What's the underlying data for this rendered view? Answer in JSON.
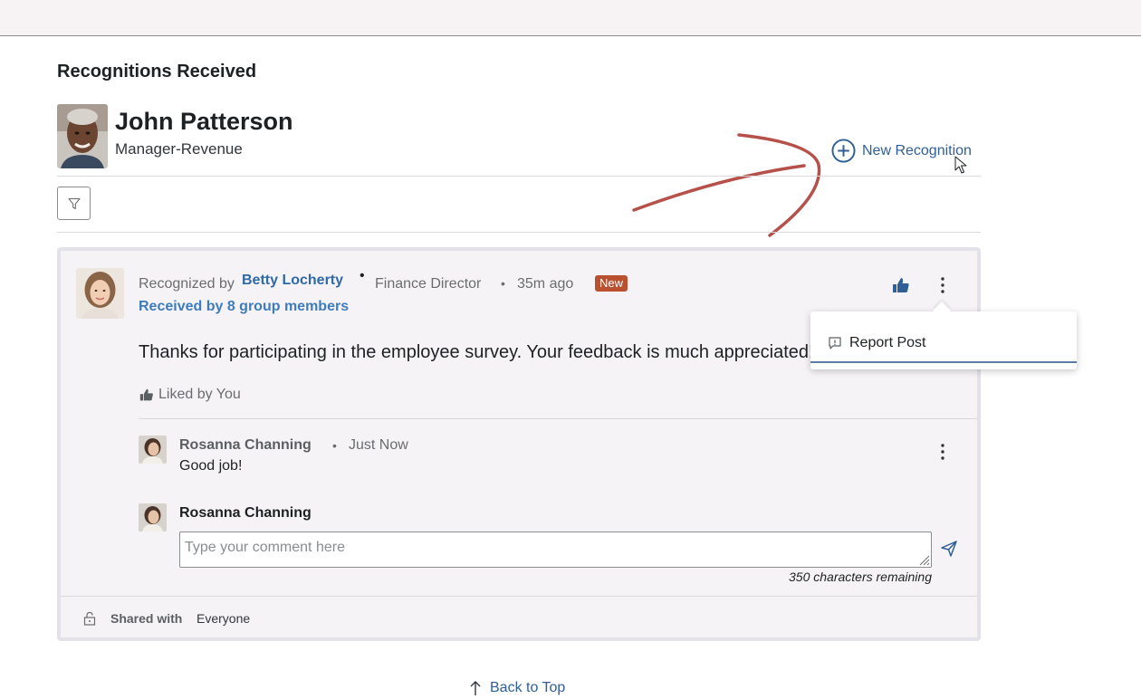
{
  "page": {
    "section_title": "Recognitions Received"
  },
  "profile": {
    "name": "John Patterson",
    "role": "Manager-Revenue"
  },
  "actions": {
    "new_recognition": "New Recognition"
  },
  "recognition": {
    "recognized_by_prefix": "Recognized by",
    "giver_name": "Betty Locherty",
    "giver_title": "Finance Director",
    "time_ago": "35m ago",
    "badge": "New",
    "received_by": "Received by 8 group members",
    "message": "Thanks for participating in the employee survey. Your feedback is much appreciated!",
    "liked_text": "Liked by You"
  },
  "comments": [
    {
      "author": "Rosanna Channing",
      "time": "Just Now",
      "text": "Good job!"
    }
  ],
  "composer": {
    "author": "Rosanna Channing",
    "placeholder": "Type your comment here",
    "chars_remaining": "350 characters remaining"
  },
  "sharing": {
    "label": "Shared with",
    "value": "Everyone"
  },
  "menu": {
    "report_post": "Report Post"
  },
  "footer": {
    "back_to_top": "Back to Top"
  },
  "colors": {
    "link_blue": "#2f5f95",
    "accent_blue": "#3f7cbd",
    "badge_red": "#b9502f",
    "annotation_red": "#b5504a"
  }
}
